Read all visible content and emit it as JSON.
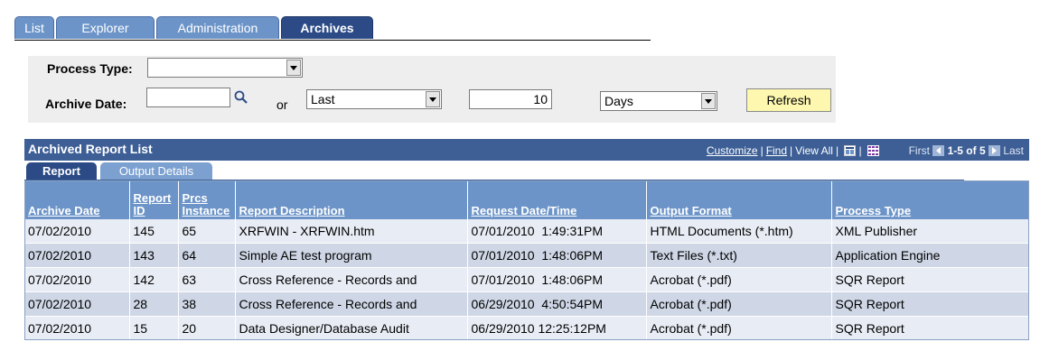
{
  "tabs": [
    {
      "label": "List"
    },
    {
      "label": "Explorer"
    },
    {
      "label": "Administration"
    },
    {
      "label": "Archives"
    }
  ],
  "search": {
    "process_type_label": "Process Type:",
    "process_type_value": "",
    "archive_date_label": "Archive Date:",
    "archive_date_value": "",
    "or_label": "or",
    "range_value": "Last",
    "count_value": "10",
    "unit_value": "Days",
    "refresh_label": "Refresh"
  },
  "grid": {
    "title": "Archived Report List",
    "customize": "Customize",
    "find": "Find",
    "view_all": "View All",
    "first": "First",
    "range": "1-5 of 5",
    "last": "Last",
    "subtabs": [
      {
        "label": "Report"
      },
      {
        "label": "Output Details"
      }
    ],
    "columns": [
      {
        "label": "Archive Date"
      },
      {
        "label": "Report ID"
      },
      {
        "label": "Prcs Instance"
      },
      {
        "label": "Report Description"
      },
      {
        "label": "Request Date/Time"
      },
      {
        "label": "Output Format"
      },
      {
        "label": "Process Type"
      }
    ],
    "rows": [
      [
        "07/02/2010",
        "145",
        "65",
        "XRFWIN - XRFWIN.htm",
        "07/01/2010  1:49:31PM",
        "HTML Documents (*.htm)",
        "XML Publisher"
      ],
      [
        "07/02/2010",
        "143",
        "64",
        "Simple AE test program",
        "07/01/2010  1:48:06PM",
        "Text Files (*.txt)",
        "Application Engine"
      ],
      [
        "07/02/2010",
        "142",
        "63",
        "Cross Reference - Records and",
        "07/01/2010  1:48:06PM",
        "Acrobat (*.pdf)",
        "SQR Report"
      ],
      [
        "07/02/2010",
        "28",
        "38",
        "Cross Reference - Records and",
        "06/29/2010  4:50:54PM",
        "Acrobat (*.pdf)",
        "SQR Report"
      ],
      [
        "07/02/2010",
        "15",
        "20",
        "Data Designer/Database Audit",
        "06/29/2010 12:25:12PM",
        "Acrobat (*.pdf)",
        "SQR Report"
      ]
    ]
  },
  "colors": {
    "tab": "#6c94c8",
    "tab_active": "#2b4a86",
    "grid_header": "#3d5f96",
    "button": "#fdf7b0"
  }
}
